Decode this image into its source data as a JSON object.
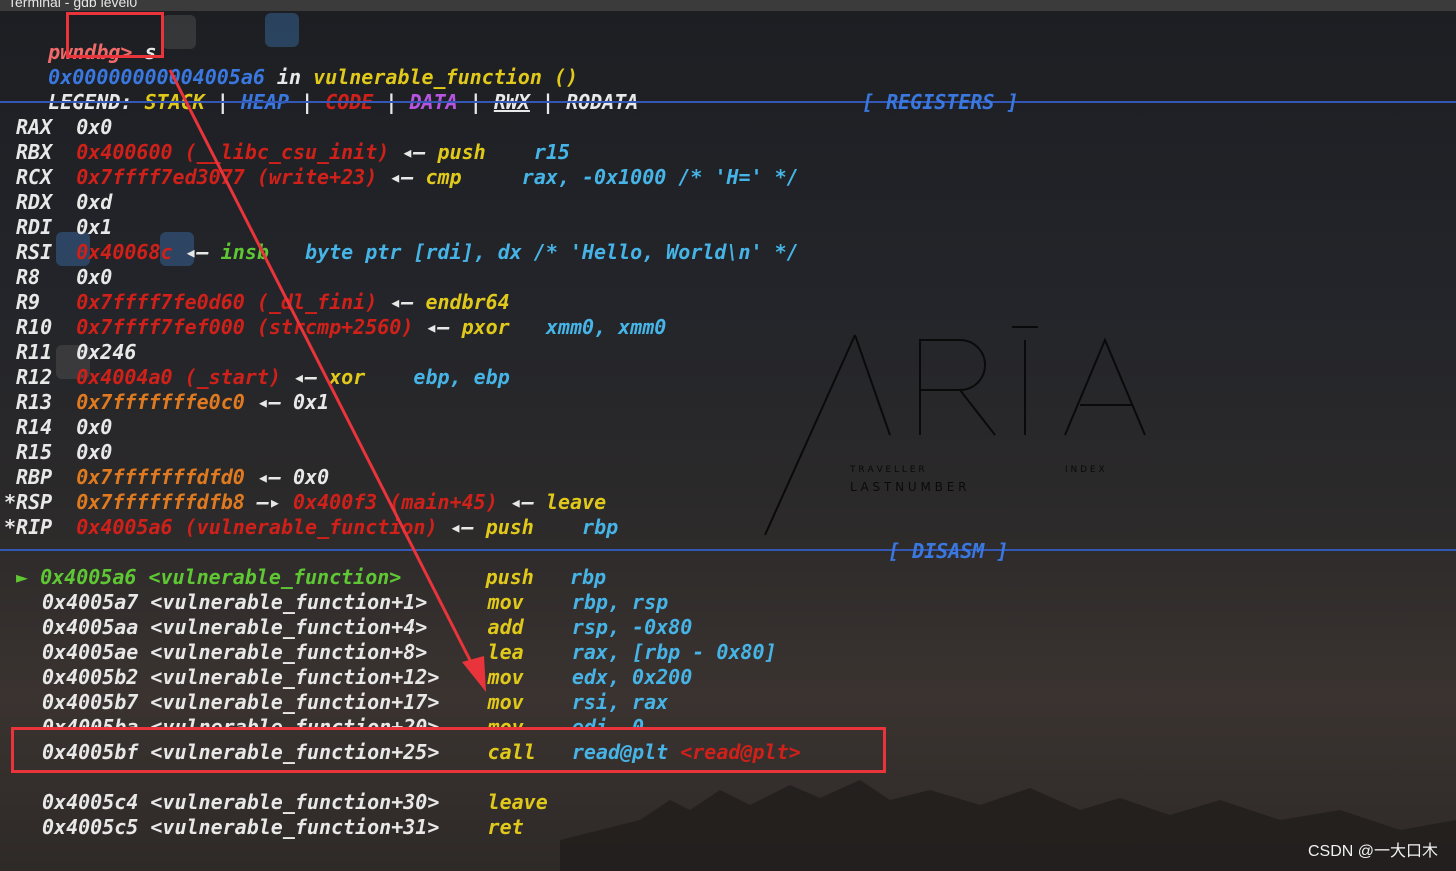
{
  "window": {
    "title": "Terminal - gdb level0"
  },
  "prompt": {
    "text": "pwndbg>",
    "command": "s"
  },
  "location": {
    "address": "0x00000000004005a6",
    "in": "in",
    "function": "vulnerable_function",
    "args": "()"
  },
  "legend": {
    "label": "LEGEND:",
    "items": [
      "STACK",
      "HEAP",
      "CODE",
      "DATA",
      "RWX",
      "RODATA"
    ],
    "sep": "|"
  },
  "sections": {
    "registers": "[ REGISTERS ]",
    "disasm": "[ DISASM ]"
  },
  "registers": [
    {
      "name": "RAX",
      "value": "0x0"
    },
    {
      "name": "RBX",
      "value": "0x400600 (__libc_csu_init)",
      "arrow": "◂—",
      "op": "push",
      "args": "r15"
    },
    {
      "name": "RCX",
      "value": "0x7ffff7ed3077 (write+23)",
      "arrow": "◂—",
      "op": "cmp",
      "args": "rax, -0x1000 /* 'H=' */"
    },
    {
      "name": "RDX",
      "value": "0xd"
    },
    {
      "name": "RDI",
      "value": "0x1"
    },
    {
      "name": "RSI",
      "value": "0x40068c",
      "arrow": "◂—",
      "op": "insb",
      "args": "byte ptr [rdi], dx /* 'Hello, World\\n' */"
    },
    {
      "name": "R8",
      "value": "0x0"
    },
    {
      "name": "R9",
      "value": "0x7ffff7fe0d60 (_dl_fini)",
      "arrow": "◂—",
      "op": "endbr64",
      "args": ""
    },
    {
      "name": "R10",
      "value": "0x7ffff7fef000 (strcmp+2560)",
      "arrow": "◂—",
      "op": "pxor",
      "args": "xmm0, xmm0"
    },
    {
      "name": "R11",
      "value": "0x246"
    },
    {
      "name": "R12",
      "value": "0x4004a0 (_start)",
      "arrow": "◂—",
      "op": "xor",
      "args": "ebp, ebp"
    },
    {
      "name": "R13",
      "value": "0x7fffffffe0c0",
      "arrow": "◂—",
      "op": "0x1",
      "args": ""
    },
    {
      "name": "R14",
      "value": "0x0"
    },
    {
      "name": "R15",
      "value": "0x0"
    },
    {
      "name": "RBP",
      "value": "0x7fffffffdfd0",
      "arrow": "◂—",
      "op": "0x0",
      "args": ""
    },
    {
      "name": "*RSP",
      "value": "0x7fffffffdfb8",
      "arrow": "—▸",
      "op": "0x400f3 (main+45)",
      "arrow2": "◂—",
      "op2": "leave"
    },
    {
      "name": "*RIP",
      "value": "0x4005a6 (vulnerable_function)",
      "arrow": "◂—",
      "op": "push",
      "args": "rbp"
    }
  ],
  "disasm": [
    {
      "marker": "►",
      "addr": "0x4005a6",
      "sym": "<vulnerable_function>",
      "op": "push",
      "args": "rbp"
    },
    {
      "marker": "",
      "addr": "0x4005a7",
      "sym": "<vulnerable_function+1>",
      "op": "mov",
      "args": "rbp, rsp"
    },
    {
      "marker": "",
      "addr": "0x4005aa",
      "sym": "<vulnerable_function+4>",
      "op": "add",
      "args": "rsp, -0x80"
    },
    {
      "marker": "",
      "addr": "0x4005ae",
      "sym": "<vulnerable_function+8>",
      "op": "lea",
      "args": "rax, [rbp - 0x80]"
    },
    {
      "marker": "",
      "addr": "0x4005b2",
      "sym": "<vulnerable_function+12>",
      "op": "mov",
      "args": "edx, 0x200"
    },
    {
      "marker": "",
      "addr": "0x4005b7",
      "sym": "<vulnerable_function+17>",
      "op": "mov",
      "args": "rsi, rax"
    },
    {
      "marker": "",
      "addr": "0x4005ba",
      "sym": "<vulnerable_function+20>",
      "op": "mov",
      "args": "edi, 0"
    },
    {
      "marker": "",
      "addr": "0x4005bf",
      "sym": "<vulnerable_function+25>",
      "op": "call",
      "args": "read@plt",
      "target": "<read@plt>"
    },
    {
      "marker": "",
      "addr": "0x4005c4",
      "sym": "<vulnerable_function+30>",
      "op": "leave",
      "args": ""
    },
    {
      "marker": "",
      "addr": "0x4005c5",
      "sym": "<vulnerable_function+31>",
      "op": "ret",
      "args": ""
    }
  ],
  "wallpaper": {
    "logo": "ARĪA",
    "sub1": "T R A V E L L E R",
    "sub1b": "I N D E X",
    "sub2": "L A S T   N U M B E R"
  },
  "watermark": "CSDN @一大口木",
  "colors": {
    "register_sep": "#3457b5",
    "highlight_box": "#e8343a",
    "value_red": "#d0201a",
    "op_yellow": "#e0c91a",
    "arg_blue": "#46b4e6",
    "current_green": "#5ec733"
  }
}
